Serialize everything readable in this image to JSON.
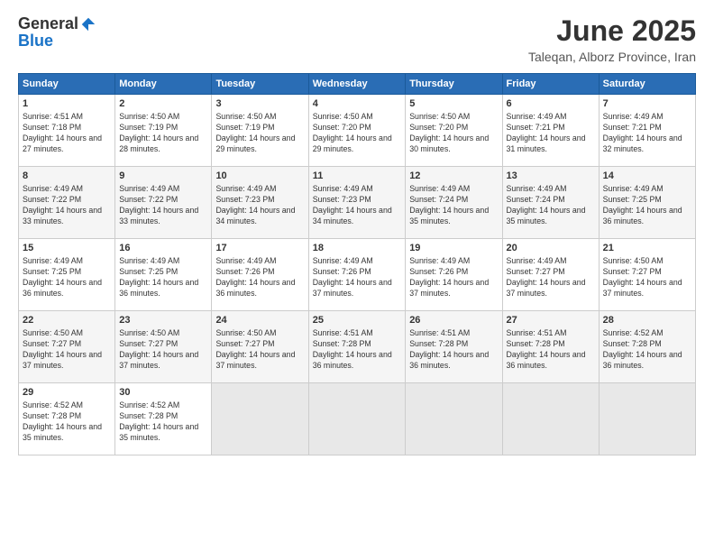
{
  "header": {
    "logo_general": "General",
    "logo_blue": "Blue",
    "month": "June 2025",
    "location": "Taleqan, Alborz Province, Iran"
  },
  "weekdays": [
    "Sunday",
    "Monday",
    "Tuesday",
    "Wednesday",
    "Thursday",
    "Friday",
    "Saturday"
  ],
  "weeks": [
    [
      {
        "day": "1",
        "sunrise": "4:51 AM",
        "sunset": "7:18 PM",
        "daylight": "14 hours and 27 minutes."
      },
      {
        "day": "2",
        "sunrise": "4:50 AM",
        "sunset": "7:19 PM",
        "daylight": "14 hours and 28 minutes."
      },
      {
        "day": "3",
        "sunrise": "4:50 AM",
        "sunset": "7:19 PM",
        "daylight": "14 hours and 29 minutes."
      },
      {
        "day": "4",
        "sunrise": "4:50 AM",
        "sunset": "7:20 PM",
        "daylight": "14 hours and 29 minutes."
      },
      {
        "day": "5",
        "sunrise": "4:50 AM",
        "sunset": "7:20 PM",
        "daylight": "14 hours and 30 minutes."
      },
      {
        "day": "6",
        "sunrise": "4:49 AM",
        "sunset": "7:21 PM",
        "daylight": "14 hours and 31 minutes."
      },
      {
        "day": "7",
        "sunrise": "4:49 AM",
        "sunset": "7:21 PM",
        "daylight": "14 hours and 32 minutes."
      }
    ],
    [
      {
        "day": "8",
        "sunrise": "4:49 AM",
        "sunset": "7:22 PM",
        "daylight": "14 hours and 33 minutes."
      },
      {
        "day": "9",
        "sunrise": "4:49 AM",
        "sunset": "7:22 PM",
        "daylight": "14 hours and 33 minutes."
      },
      {
        "day": "10",
        "sunrise": "4:49 AM",
        "sunset": "7:23 PM",
        "daylight": "14 hours and 34 minutes."
      },
      {
        "day": "11",
        "sunrise": "4:49 AM",
        "sunset": "7:23 PM",
        "daylight": "14 hours and 34 minutes."
      },
      {
        "day": "12",
        "sunrise": "4:49 AM",
        "sunset": "7:24 PM",
        "daylight": "14 hours and 35 minutes."
      },
      {
        "day": "13",
        "sunrise": "4:49 AM",
        "sunset": "7:24 PM",
        "daylight": "14 hours and 35 minutes."
      },
      {
        "day": "14",
        "sunrise": "4:49 AM",
        "sunset": "7:25 PM",
        "daylight": "14 hours and 36 minutes."
      }
    ],
    [
      {
        "day": "15",
        "sunrise": "4:49 AM",
        "sunset": "7:25 PM",
        "daylight": "14 hours and 36 minutes."
      },
      {
        "day": "16",
        "sunrise": "4:49 AM",
        "sunset": "7:25 PM",
        "daylight": "14 hours and 36 minutes."
      },
      {
        "day": "17",
        "sunrise": "4:49 AM",
        "sunset": "7:26 PM",
        "daylight": "14 hours and 36 minutes."
      },
      {
        "day": "18",
        "sunrise": "4:49 AM",
        "sunset": "7:26 PM",
        "daylight": "14 hours and 37 minutes."
      },
      {
        "day": "19",
        "sunrise": "4:49 AM",
        "sunset": "7:26 PM",
        "daylight": "14 hours and 37 minutes."
      },
      {
        "day": "20",
        "sunrise": "4:49 AM",
        "sunset": "7:27 PM",
        "daylight": "14 hours and 37 minutes."
      },
      {
        "day": "21",
        "sunrise": "4:50 AM",
        "sunset": "7:27 PM",
        "daylight": "14 hours and 37 minutes."
      }
    ],
    [
      {
        "day": "22",
        "sunrise": "4:50 AM",
        "sunset": "7:27 PM",
        "daylight": "14 hours and 37 minutes."
      },
      {
        "day": "23",
        "sunrise": "4:50 AM",
        "sunset": "7:27 PM",
        "daylight": "14 hours and 37 minutes."
      },
      {
        "day": "24",
        "sunrise": "4:50 AM",
        "sunset": "7:27 PM",
        "daylight": "14 hours and 37 minutes."
      },
      {
        "day": "25",
        "sunrise": "4:51 AM",
        "sunset": "7:28 PM",
        "daylight": "14 hours and 36 minutes."
      },
      {
        "day": "26",
        "sunrise": "4:51 AM",
        "sunset": "7:28 PM",
        "daylight": "14 hours and 36 minutes."
      },
      {
        "day": "27",
        "sunrise": "4:51 AM",
        "sunset": "7:28 PM",
        "daylight": "14 hours and 36 minutes."
      },
      {
        "day": "28",
        "sunrise": "4:52 AM",
        "sunset": "7:28 PM",
        "daylight": "14 hours and 36 minutes."
      }
    ],
    [
      {
        "day": "29",
        "sunrise": "4:52 AM",
        "sunset": "7:28 PM",
        "daylight": "14 hours and 35 minutes."
      },
      {
        "day": "30",
        "sunrise": "4:52 AM",
        "sunset": "7:28 PM",
        "daylight": "14 hours and 35 minutes."
      },
      null,
      null,
      null,
      null,
      null
    ]
  ]
}
